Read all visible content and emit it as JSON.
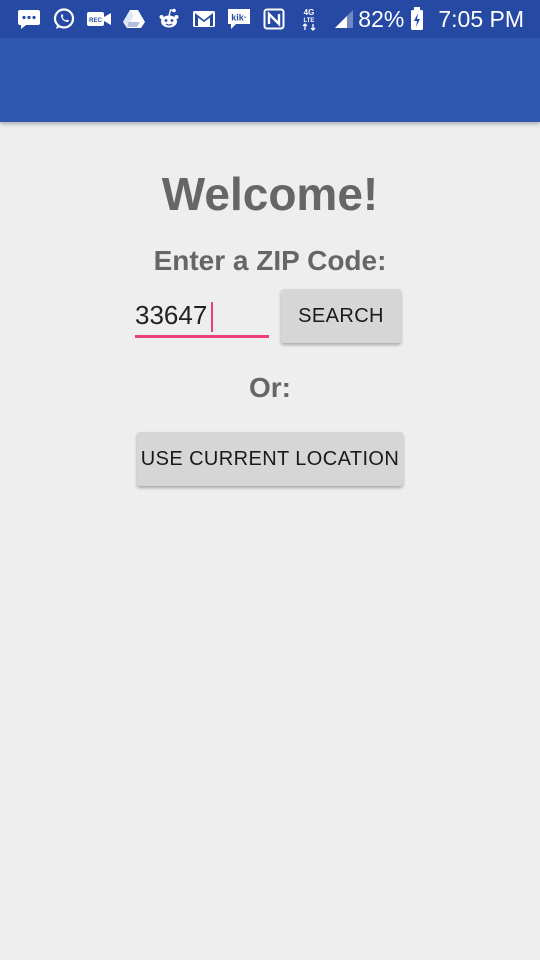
{
  "status_bar": {
    "battery": "82%",
    "time": "7:05 PM",
    "background_color": "#2649a3",
    "icons_left": [
      "messages-icon",
      "whatsapp-icon",
      "video-recorder-icon",
      "drive-icon",
      "reddit-alien-icon",
      "gmail-icon",
      "kik-icon",
      "nfc-icon",
      "network-4g-lte-icon",
      "signal-icon"
    ]
  },
  "app_bar": {
    "background_color": "#2f58b0"
  },
  "main": {
    "title": "Welcome!",
    "zip_label": "Enter a ZIP Code:",
    "zip_input": {
      "value": "33647",
      "placeholder": ""
    },
    "search_button": "SEARCH",
    "or_label": "Or:",
    "location_button": "USE CURRENT LOCATION",
    "accent_color": "#ec407a"
  }
}
